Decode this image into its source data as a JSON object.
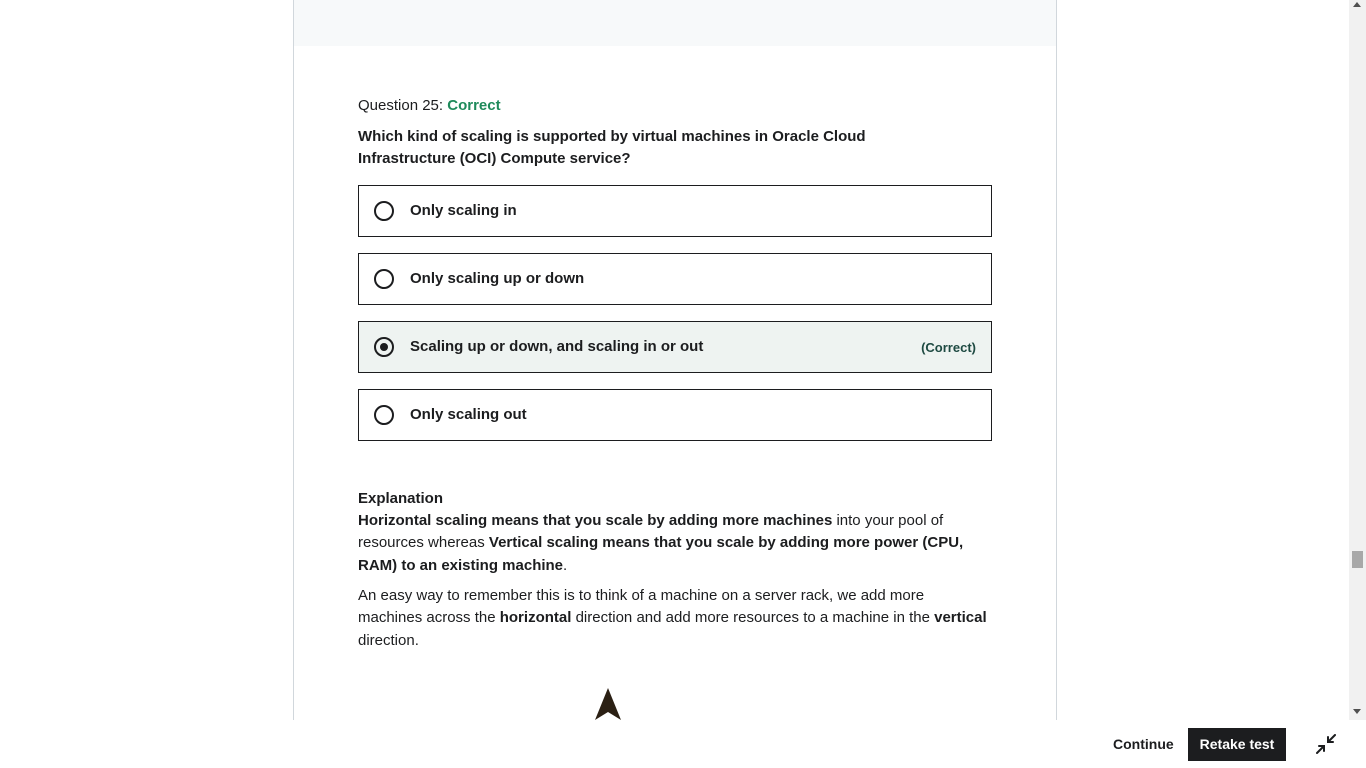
{
  "question": {
    "header_prefix": "Question 25: ",
    "status": "Correct",
    "text": "Which kind of scaling is supported by virtual machines in Oracle Cloud Infrastructure (OCI) Compute service?",
    "options": [
      {
        "label": "Only scaling in",
        "selected": false,
        "note": ""
      },
      {
        "label": "Only scaling up or down",
        "selected": false,
        "note": ""
      },
      {
        "label": "Scaling up or down, and scaling in or out",
        "selected": true,
        "note": "(Correct)"
      },
      {
        "label": "Only scaling out",
        "selected": false,
        "note": ""
      }
    ]
  },
  "explanation": {
    "title": "Explanation",
    "p1": {
      "b1": "Horizontal scaling means that you scale by adding more machines",
      "t1": " into your pool of resources whereas ",
      "b2": "Vertical scaling means that you scale by adding more power (CPU, RAM) to an existing machine",
      "t2": "."
    },
    "p2": {
      "t1": "An easy way to remember this is to think of a machine on a server rack, we add more machines across the ",
      "b1": "horizontal",
      "t2": " direction and add more resources to a machine in the ",
      "b2": "vertical",
      "t3": " direction."
    }
  },
  "footer": {
    "continue_label": "Continue",
    "retake_label": "Retake test"
  },
  "colors": {
    "correct_status": "#1f8a5b",
    "selected_bg": "#eef3f1",
    "retake_bg": "#1c1d1f"
  },
  "icons": {
    "collapse": "collapse-icon",
    "radio": "radio-icon",
    "arrow": "arrow-up-icon"
  }
}
